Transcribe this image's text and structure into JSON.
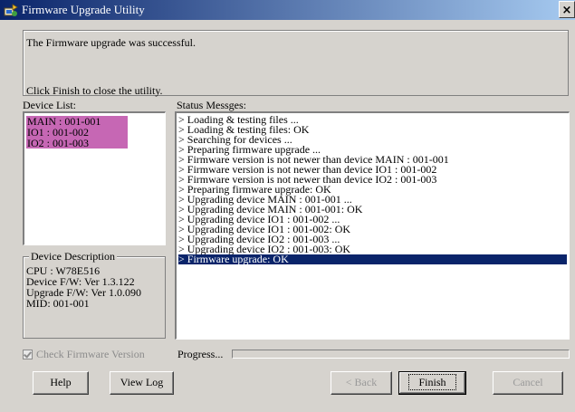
{
  "window": {
    "title": "Firmware Upgrade Utility",
    "close_glyph": "×"
  },
  "message": {
    "line1": "The Firmware upgrade was successful.",
    "line2": "Click Finish to close the utility."
  },
  "device_list": {
    "label": "Device List:",
    "items": [
      "MAIN : 001-001",
      "IO1 : 001-002",
      "IO2 : 001-003"
    ]
  },
  "status": {
    "label": "Status Messges:",
    "lines": [
      "> Loading & testing files ...",
      "> Loading & testing files: OK",
      "> Searching for devices ...",
      "> Preparing firmware upgrade ...",
      "> Firmware version is not newer than device MAIN : 001-001",
      "> Firmware version is not newer than device IO1 : 001-002",
      "> Firmware version is not newer than device IO2 : 001-003",
      "> Preparing firmware upgrade: OK",
      "> Upgrading device MAIN : 001-001 ...",
      "> Upgrading device MAIN : 001-001: OK",
      "> Upgrading device IO1 : 001-002 ...",
      "> Upgrading device IO1 : 001-002: OK",
      "> Upgrading device IO2 : 001-003 ...",
      "> Upgrading device IO2 : 001-003: OK",
      "> Firmware upgrade: OK"
    ],
    "selected_index": 14
  },
  "device_description": {
    "legend": "Device Description",
    "lines": [
      "CPU : W78E516",
      "Device F/W: Ver 1.3.122",
      "Upgrade F/W: Ver 1.0.090",
      "MID: 001-001"
    ]
  },
  "check_firmware": {
    "label": "Check Firmware Version",
    "checked": true,
    "enabled": false
  },
  "progress": {
    "label": "Progress...",
    "percent": 0
  },
  "buttons": {
    "help": "Help",
    "view_log": "View Log",
    "back": "< Back",
    "finish": "Finish",
    "cancel": "Cancel"
  },
  "colors": {
    "device_highlight": "#c667b4",
    "selection": "#0a246a",
    "face": "#d6d3ce"
  }
}
